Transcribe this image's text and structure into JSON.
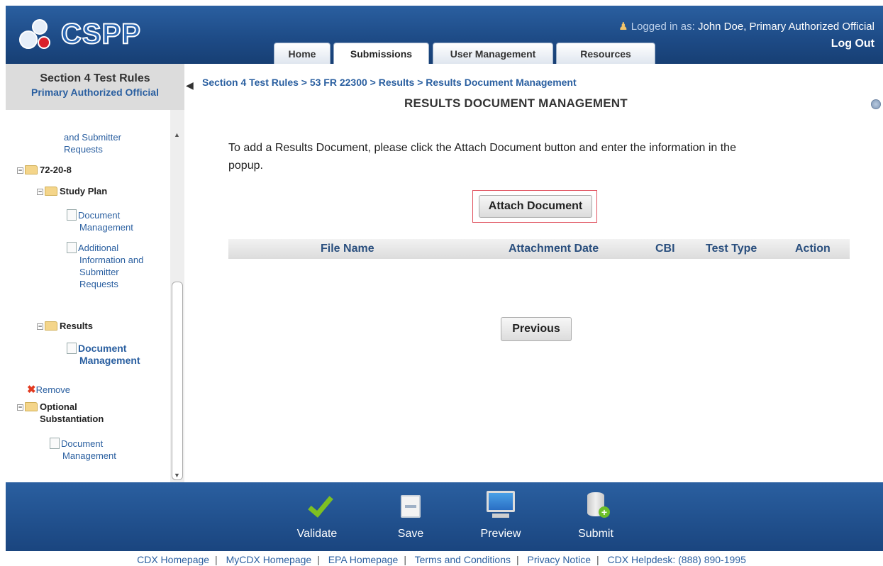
{
  "header": {
    "logo_text": "CSPP",
    "logged_in_prefix": "Logged in as: ",
    "user": "John Doe, Primary Authorized Official",
    "logout": "Log Out",
    "tabs": [
      {
        "label": "Home"
      },
      {
        "label": "Submissions",
        "active": true
      },
      {
        "label": "User Management"
      },
      {
        "label": "Resources"
      }
    ]
  },
  "sidebar": {
    "title": "Section 4 Test Rules",
    "subtitle": "Primary Authorized Official",
    "tree": {
      "item_top_1": "and Submitter",
      "item_top_2": "Requests",
      "folder_case": "72-20-8",
      "folder_study_plan": "Study Plan",
      "doc_mgmt_1a": "Document",
      "doc_mgmt_1b": "Management",
      "addl_1": "Additional",
      "addl_2": "Information and",
      "addl_3": "Submitter",
      "addl_4": "Requests",
      "folder_results": "Results",
      "doc_mgmt_2a": "Document",
      "doc_mgmt_2b": "Management",
      "remove": "Remove",
      "folder_optional_1": "Optional",
      "folder_optional_2": "Substantiation",
      "doc_mgmt_3a": "Document",
      "doc_mgmt_3b": "Management"
    }
  },
  "main": {
    "breadcrumb": "Section 4 Test Rules > 53 FR 22300 > Results > Results Document Management",
    "title": "RESULTS DOCUMENT MANAGEMENT",
    "instruction_line1": "To add a Results Document, please click the Attach Document button and enter the information in the",
    "instruction_line2": "popup.",
    "attach_button": "Attach Document",
    "table_headers": [
      "File Name",
      "Attachment Date",
      "CBI",
      "Test Type",
      "Action"
    ],
    "previous_button": "Previous"
  },
  "footer": {
    "actions": [
      {
        "label": "Validate",
        "icon": "check-icon"
      },
      {
        "label": "Save",
        "icon": "floppy-icon"
      },
      {
        "label": "Preview",
        "icon": "monitor-icon"
      },
      {
        "label": "Submit",
        "icon": "database-icon"
      }
    ],
    "links": [
      "CDX Homepage",
      "MyCDX Homepage",
      "EPA Homepage",
      "Terms and Conditions",
      "Privacy Notice",
      "CDX Helpdesk: (888) 890-1995"
    ]
  },
  "colors": {
    "header_blue": "#1d4a85",
    "link_blue": "#2a5fa0",
    "validate_green": "#7ec022"
  }
}
